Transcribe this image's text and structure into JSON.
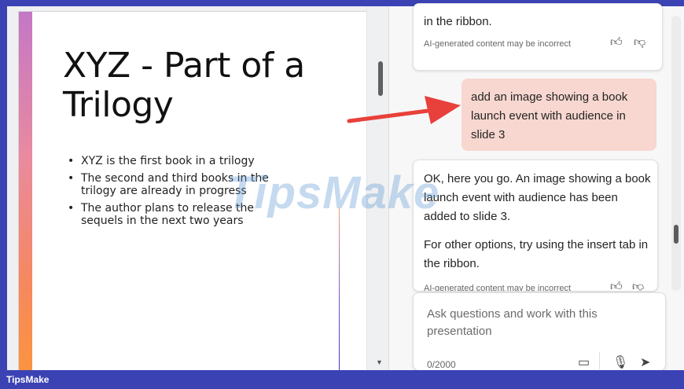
{
  "slide": {
    "title": "XYZ - Part of a Trilogy",
    "bullets": [
      "XYZ is the first book in a trilogy",
      "The second and third books in the trilogy are already in progress",
      "The author plans to release the sequels in the next two years"
    ]
  },
  "chat": {
    "messages": [
      {
        "role": "assistant",
        "text": "in the ribbon.",
        "disclaimer": "AI-generated content may be incorrect"
      },
      {
        "role": "user",
        "text": "add an image showing a book launch event with audience in slide 3"
      },
      {
        "role": "assistant",
        "text": "OK, here you go. An image showing a book launch event with audience has been added to slide 3.",
        "text2": "For other options, try using the insert tab in the ribbon.",
        "disclaimer": "AI-generated content may be incorrect"
      }
    ],
    "input": {
      "placeholder": "Ask questions and work with this presentation",
      "counter": "0/2000"
    }
  },
  "watermark": "TipsMake",
  "footer": {
    "label": "TipsMake"
  },
  "colors": {
    "frame": "#3b42b4",
    "user_bubble": "#f7d7cf",
    "arrow": "#e8403a"
  }
}
